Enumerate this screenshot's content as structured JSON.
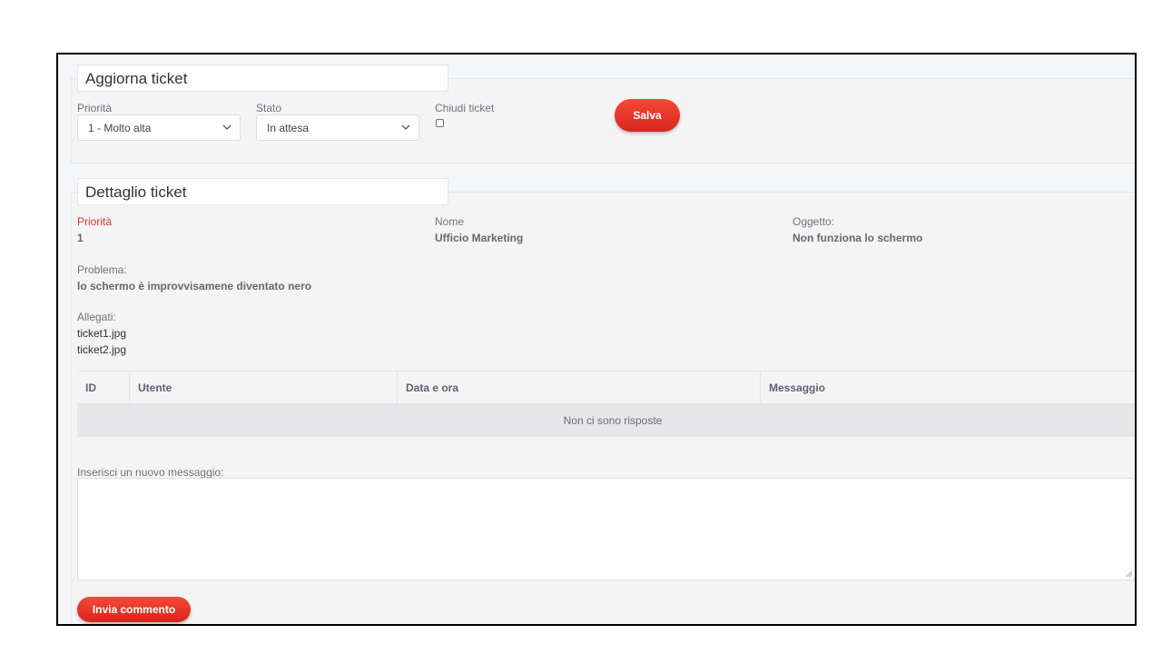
{
  "update": {
    "title": "Aggiorna ticket",
    "priority": {
      "label": "Priorità",
      "selected": "1 - Molto alta"
    },
    "status": {
      "label": "Stato",
      "selected": "In attesa"
    },
    "close": {
      "label": "Chiudi ticket",
      "checked": false
    },
    "save_label": "Salva"
  },
  "detail": {
    "title": "Dettaglio ticket",
    "priority": {
      "label": "Priorità",
      "value": "1"
    },
    "name": {
      "label": "Nome",
      "value": "Ufficio Marketing"
    },
    "subject": {
      "label": "Oggetto:",
      "value": "Non funziona lo schermo"
    },
    "problem": {
      "label": "Problema:",
      "value": "lo schermo è improvvisamene diventato nero"
    },
    "attachments": {
      "label": "Allegati:",
      "files": [
        "ticket1.jpg",
        "ticket2.jpg"
      ]
    }
  },
  "replies_table": {
    "columns": [
      "ID",
      "Utente",
      "Data e ora",
      "Messaggio"
    ],
    "empty_message": "Non ci sono risposte"
  },
  "new_message": {
    "label": "Inserisci un nuovo messaggio:",
    "value": "",
    "send_label": "Invia commento"
  },
  "colors": {
    "accent": "#e3352a",
    "label_red": "#d93636",
    "panel_bg": "#f4f4f5"
  }
}
